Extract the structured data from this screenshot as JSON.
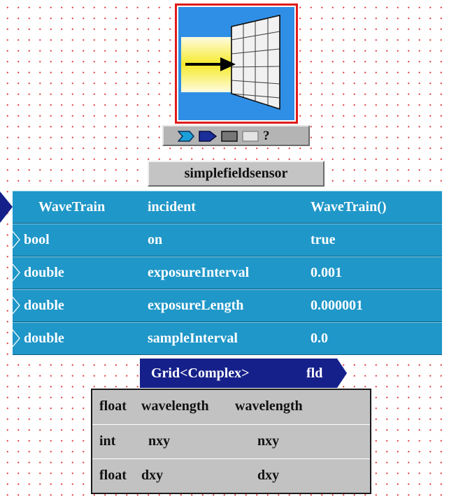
{
  "module": {
    "title": "simplefieldsensor",
    "icon": "field-sensor-grid-icon",
    "controls": [
      {
        "icon": "input-port-icon",
        "color": "#1aa0d8"
      },
      {
        "icon": "output-port-icon",
        "color": "#1a2f9a"
      },
      {
        "icon": "params-box-icon",
        "color": "#777777"
      },
      {
        "icon": "blank-box-icon",
        "color": "#e4e4e4"
      },
      {
        "label": "?"
      }
    ]
  },
  "params": [
    {
      "type": "WaveTrain",
      "name": "incident",
      "value": "WaveTrain()"
    },
    {
      "type": "bool",
      "name": "on",
      "value": "true"
    },
    {
      "type": "double",
      "name": "exposureInterval",
      "value": "0.001"
    },
    {
      "type": "double",
      "name": "exposureLength",
      "value": "0.000001"
    },
    {
      "type": "double",
      "name": "sampleInterval",
      "value": "0.0"
    }
  ],
  "output": {
    "type": "Grid<Complex>",
    "name": "fld"
  },
  "sub_params": [
    {
      "type": "float",
      "name": "wavelength",
      "value": "wavelength"
    },
    {
      "type": "int",
      "name": "nxy",
      "value": "nxy"
    },
    {
      "type": "float",
      "name": "dxy",
      "value": "dxy"
    }
  ],
  "colors": {
    "row_bg": "#1f97c8",
    "output_bg": "#16208a",
    "tile_border": "#e01b1b",
    "tile_bg": "#2f8fe6",
    "grid_dots": "#e23a3a"
  }
}
